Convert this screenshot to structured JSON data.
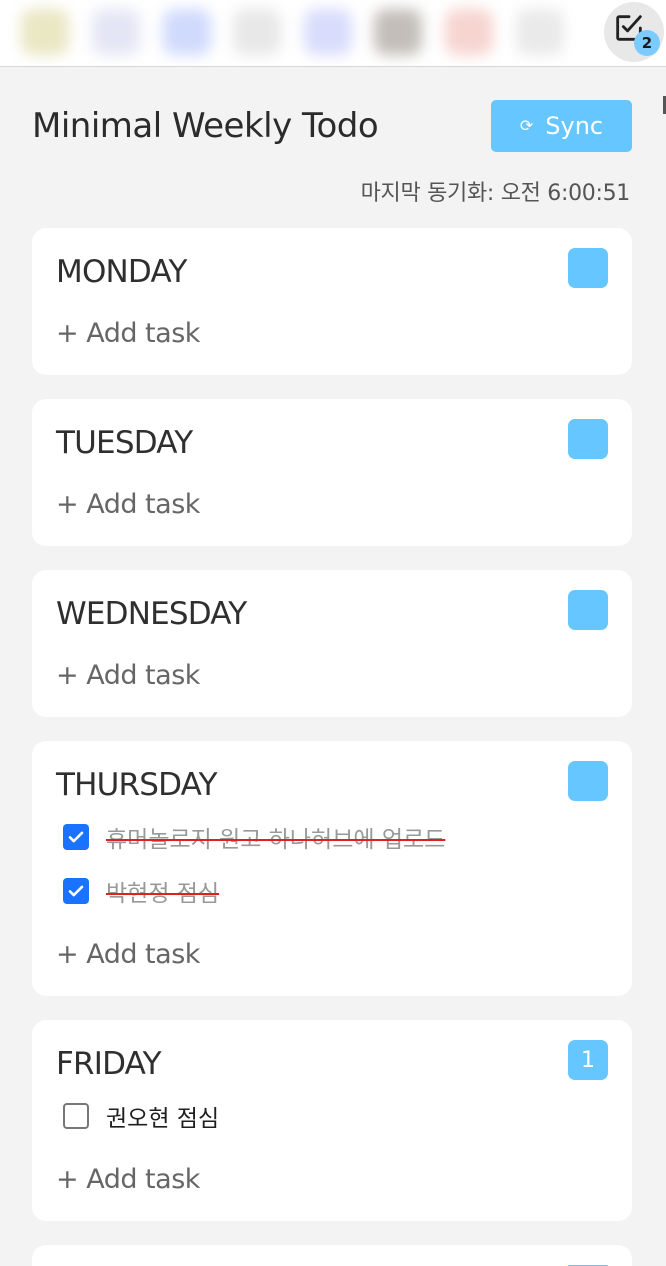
{
  "extension_bar": {
    "icon_colors": [
      "#e6e3b8",
      "#dfe2f3",
      "#c8d4fb",
      "#e4e4e4",
      "#d2d6fb",
      "#b9b3ad",
      "#f5cdc7",
      "#e6e6e6"
    ],
    "active_extension": {
      "icon": "edit-checkbox-icon",
      "badge": "2"
    }
  },
  "header": {
    "title": "Minimal Weekly Todo",
    "sync_label": "Sync",
    "sync_icon": "⟳",
    "last_sync": "마지막 동기화: 오전 6:00:51"
  },
  "colors": {
    "accent": "#66c6ff",
    "checkbox_checked": "#1a73ff",
    "strike": "#e02020"
  },
  "days": [
    {
      "name": "MONDAY",
      "count": "",
      "add_label": "+ Add task",
      "tasks": []
    },
    {
      "name": "TUESDAY",
      "count": "",
      "add_label": "+ Add task",
      "tasks": []
    },
    {
      "name": "WEDNESDAY",
      "count": "",
      "add_label": "+ Add task",
      "tasks": []
    },
    {
      "name": "THURSDAY",
      "count": "",
      "add_label": "+ Add task",
      "tasks": [
        {
          "text": "휴머놀로지 원고 하나허브에 업로드",
          "done": true
        },
        {
          "text": "박현정 점심",
          "done": true
        }
      ]
    },
    {
      "name": "FRIDAY",
      "count": "1",
      "add_label": "+ Add task",
      "tasks": [
        {
          "text": "권오현 점심",
          "done": false
        }
      ]
    }
  ]
}
